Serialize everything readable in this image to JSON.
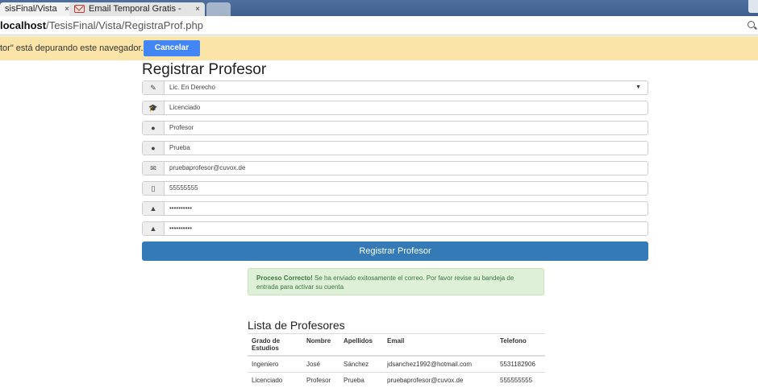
{
  "browser": {
    "tabs": [
      {
        "label": "sisFinal/Vista",
        "close": "×"
      },
      {
        "label": "Email Temporal Gratis - ",
        "close": "×"
      }
    ],
    "url": {
      "host": "localhost",
      "path": "/TesisFinal/Vista/RegistraProf.php"
    },
    "debug_message": "tor\" está depurando este navegador.",
    "cancel_label": "Cancelar"
  },
  "form": {
    "title": "Registrar Profesor",
    "fields": [
      {
        "icon": "pencil-icon",
        "value": "Lic. En Derecho",
        "type": "select"
      },
      {
        "icon": "graduation-cap-icon",
        "value": "Licenciado"
      },
      {
        "icon": "user-icon",
        "value": "Profesor"
      },
      {
        "icon": "user-icon",
        "value": "Prueba"
      },
      {
        "icon": "envelope-icon",
        "value": "pruebaprofesor@cuvox.de"
      },
      {
        "icon": "phone-icon",
        "value": "55555555"
      },
      {
        "icon": "lock-icon",
        "value": "••••••••••"
      },
      {
        "icon": "lock-icon",
        "value": "••••••••••"
      }
    ],
    "submit_label": "Registrar Profesor"
  },
  "alert": {
    "strong": "Proceso Correcto!",
    "text": "Se ha enviado exitosamente el correo. Por favor revise su bandeja de entrada para activar su cuenta"
  },
  "list": {
    "title": "Lista de Profesores",
    "columns": [
      "Grado de Estudios",
      "Nombre",
      "Apellidos",
      "Email",
      "Telefono"
    ],
    "rows": [
      [
        "Ingeniero",
        "José",
        "Sánchez",
        "jdsanchez1992@hotmail.com",
        "5531182906"
      ],
      [
        "Licenciado",
        "Profesor",
        "Prueba",
        "pruebaprofesor@cuvox.de",
        "555555555"
      ]
    ]
  },
  "colors": {
    "primary": "#337ab7",
    "alert_bg": "#dff0d8",
    "debug_bg": "#fae4a8",
    "cancel": "#4285f4"
  }
}
